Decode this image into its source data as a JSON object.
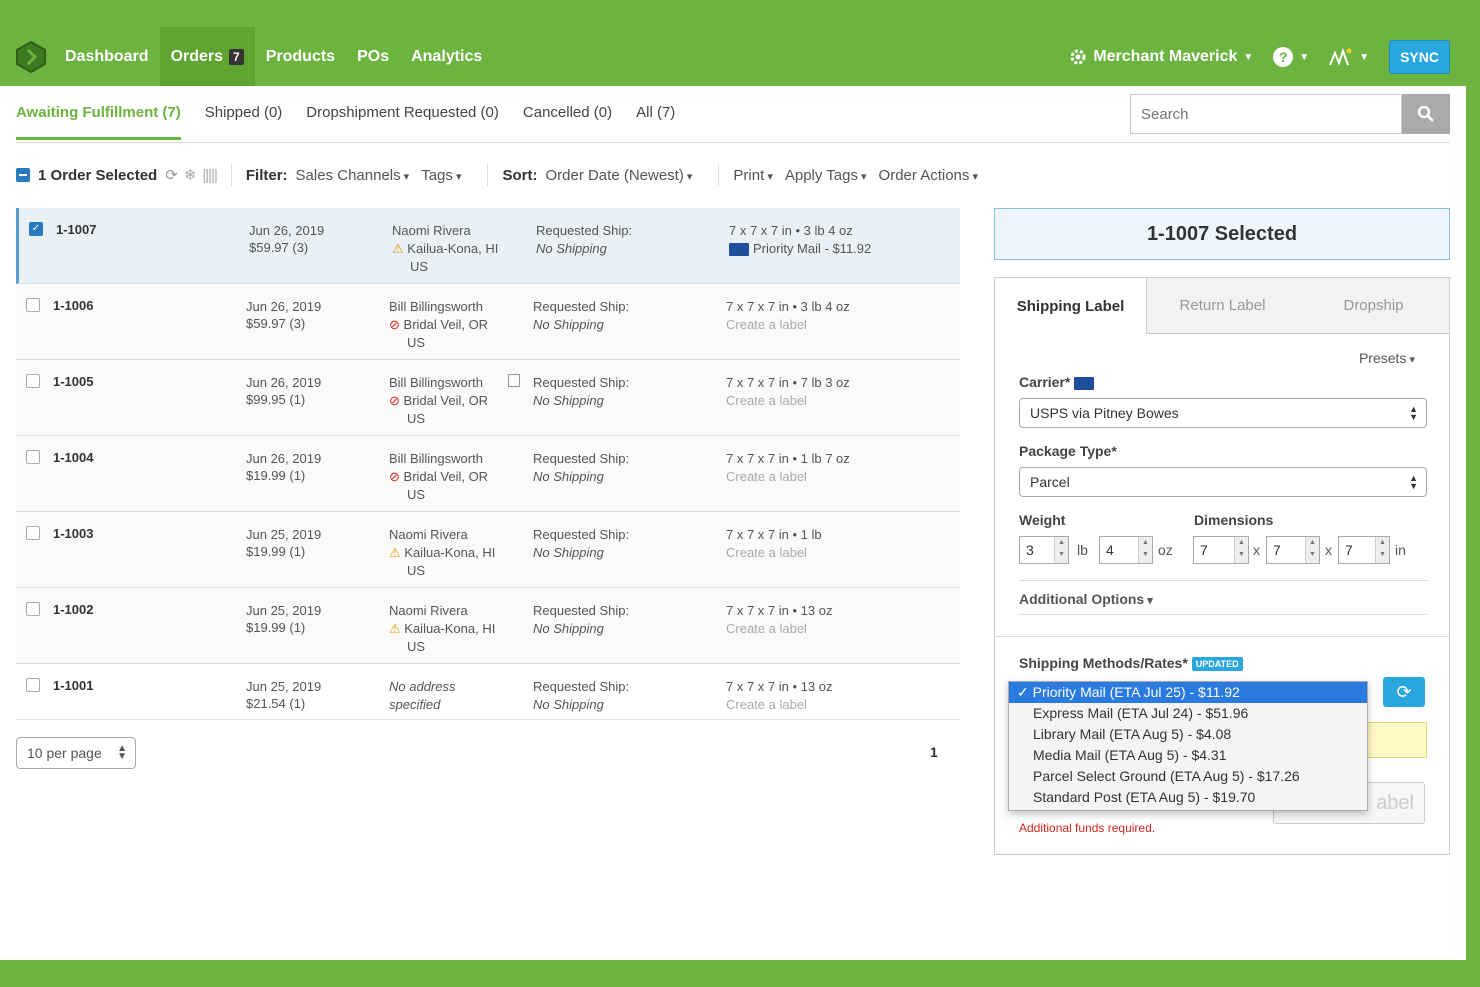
{
  "nav": {
    "items": [
      {
        "label": "Dashboard"
      },
      {
        "label": "Orders",
        "badge": "7"
      },
      {
        "label": "Products"
      },
      {
        "label": "POs"
      },
      {
        "label": "Analytics"
      }
    ],
    "merchant": "Merchant Maverick",
    "sync": "SYNC"
  },
  "tabs": [
    "Awaiting Fulfillment (7)",
    "Shipped (0)",
    "Dropshipment Requested (0)",
    "Cancelled (0)",
    "All (7)"
  ],
  "search": {
    "placeholder": "Search"
  },
  "toolbar": {
    "selected": "1 Order Selected",
    "filter_label": "Filter:",
    "sales_channels": "Sales Channels",
    "tags": "Tags",
    "sort_label": "Sort:",
    "sort_value": "Order Date (Newest)",
    "print": "Print",
    "apply_tags": "Apply Tags",
    "order_actions": "Order Actions"
  },
  "orders": [
    {
      "id": "1-1007",
      "date": "Jun 26, 2019",
      "total": "$59.97 (3)",
      "name": "Naomi Rivera",
      "loc": "Kailua-Kona, HI",
      "country": "US",
      "status": "warn",
      "ship_label": "Requested Ship:",
      "ship": "No Shipping",
      "pkg": "7 x 7 x 7 in • 3 lb 4 oz",
      "label": "Priority Mail - $11.92"
    },
    {
      "id": "1-1006",
      "date": "Jun 26, 2019",
      "total": "$59.97 (3)",
      "name": "Bill Billingsworth",
      "loc": "Bridal Veil, OR",
      "country": "US",
      "status": "no",
      "ship_label": "Requested Ship:",
      "ship": "No Shipping",
      "pkg": "7 x 7 x 7 in • 3 lb 4 oz",
      "label": "Create a label"
    },
    {
      "id": "1-1005",
      "date": "Jun 26, 2019",
      "total": "$99.95 (1)",
      "name": "Bill Billingsworth",
      "loc": "Bridal Veil, OR",
      "country": "US",
      "status": "no",
      "ship_label": "Requested Ship:",
      "ship": "No Shipping",
      "pkg": "7 x 7 x 7 in • 7 lb 3 oz",
      "label": "Create a label"
    },
    {
      "id": "1-1004",
      "date": "Jun 26, 2019",
      "total": "$19.99 (1)",
      "name": "Bill Billingsworth",
      "loc": "Bridal Veil, OR",
      "country": "US",
      "status": "no",
      "ship_label": "Requested Ship:",
      "ship": "No Shipping",
      "pkg": "7 x 7 x 7 in • 1 lb 7 oz",
      "label": "Create a label"
    },
    {
      "id": "1-1003",
      "date": "Jun 25, 2019",
      "total": "$19.99 (1)",
      "name": "Naomi Rivera",
      "loc": "Kailua-Kona, HI",
      "country": "US",
      "status": "warn",
      "ship_label": "Requested Ship:",
      "ship": "No Shipping",
      "pkg": "7 x 7 x 7 in • 1 lb",
      "label": "Create a label"
    },
    {
      "id": "1-1002",
      "date": "Jun 25, 2019",
      "total": "$19.99 (1)",
      "name": "Naomi Rivera",
      "loc": "Kailua-Kona, HI",
      "country": "US",
      "status": "warn",
      "ship_label": "Requested Ship:",
      "ship": "No Shipping",
      "pkg": "7 x 7 x 7 in • 13 oz",
      "label": "Create a label"
    },
    {
      "id": "1-1001",
      "date": "Jun 25, 2019",
      "total": "$21.54 (1)",
      "addr_line1": "No address",
      "addr_line2": "specified",
      "ship_label": "Requested Ship:",
      "ship": "No Shipping",
      "pkg": "7 x 7 x 7 in • 13 oz",
      "label": "Create a label"
    }
  ],
  "pagination": {
    "per_page": "10 per page",
    "page": "1"
  },
  "panel": {
    "selected_title": "1-1007 Selected",
    "tabs": [
      "Shipping Label",
      "Return Label",
      "Dropship"
    ],
    "presets": "Presets",
    "carrier_label": "Carrier*",
    "carrier_value": "USPS via Pitney Bowes",
    "package_label": "Package Type*",
    "package_value": "Parcel",
    "weight_label": "Weight",
    "weight_lb": "3",
    "weight_oz": "4",
    "lb_unit": "lb",
    "oz_unit": "oz",
    "dimensions_label": "Dimensions",
    "dim_l": "7",
    "dim_w": "7",
    "dim_h": "7",
    "x": "x",
    "in_unit": "in",
    "additional": "Additional Options",
    "methods_label": "Shipping Methods/Rates*",
    "updated": "UPDATED",
    "label_btn": "abel",
    "funds": "Additional funds required."
  },
  "methods": [
    "Priority Mail (ETA Jul 25) - $11.92",
    "Express Mail (ETA Jul 24) - $51.96",
    "Library Mail (ETA Aug 5) - $4.08",
    "Media Mail (ETA Aug 5) - $4.31",
    "Parcel Select Ground (ETA Aug 5) - $17.26",
    "Standard Post (ETA Aug 5) - $19.70"
  ],
  "colors": {
    "brand": "#6db33f",
    "accent": "#2aa7df"
  }
}
